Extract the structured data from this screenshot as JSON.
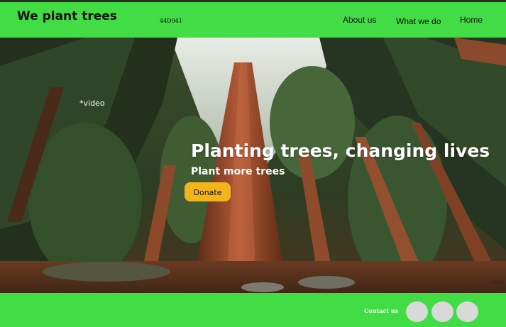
{
  "header": {
    "brand": "We plant trees",
    "code": "44D941",
    "nav": {
      "about": "About us",
      "what_we_do": "What we do",
      "home": "Home"
    }
  },
  "hero": {
    "video_placeholder": "*video",
    "title": "Planting trees, changing lives",
    "subtitle": "Plant more trees",
    "donate_label": "Donate",
    "corner_mark": "Jd9cb3"
  },
  "footer": {
    "contact": "Contact us",
    "social_icons": [
      "social-circle",
      "social-circle",
      "social-circle"
    ]
  },
  "colors": {
    "brand_green": "#42dc44",
    "donate_yellow": "#f2b51b",
    "social_gray": "#d9d9d9"
  }
}
